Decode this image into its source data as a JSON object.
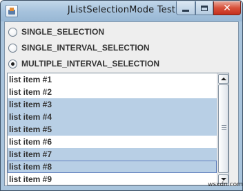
{
  "window": {
    "title": "JListSelectionMode Test",
    "close_glyph": "✕",
    "icons": {
      "app": "java-app-icon",
      "minimize": "minimize-icon",
      "maximize": "maximize-icon",
      "close": "close-icon"
    }
  },
  "radios": [
    {
      "label": "SINGLE_SELECTION",
      "checked": false
    },
    {
      "label": "SINGLE_INTERVAL_SELECTION",
      "checked": false
    },
    {
      "label": "MULTIPLE_INTERVAL_SELECTION",
      "checked": true
    }
  ],
  "list": {
    "items": [
      {
        "label": "list item #1",
        "selected": false
      },
      {
        "label": "list item #2",
        "selected": false
      },
      {
        "label": "list item #3",
        "selected": true
      },
      {
        "label": "list item #4",
        "selected": true
      },
      {
        "label": "list item #5",
        "selected": true
      },
      {
        "label": "list item #6",
        "selected": false
      },
      {
        "label": "list item #7",
        "selected": true
      },
      {
        "label": "list item #8",
        "selected": true,
        "focused": true
      },
      {
        "label": "list item #9",
        "selected": false
      }
    ]
  },
  "watermark": "wsxdn.com",
  "colors": {
    "selection": "#b8cfe5",
    "focus_border": "#6382bf",
    "close_button": "#d8503a",
    "title_bar": "#a9c4dc"
  }
}
